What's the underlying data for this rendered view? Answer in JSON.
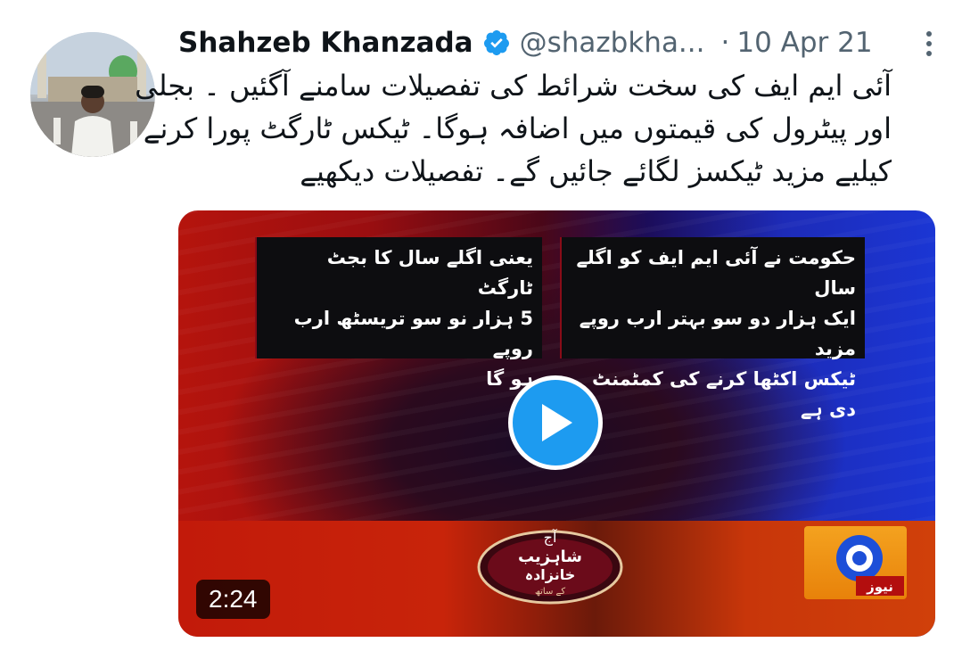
{
  "tweet": {
    "author_name": "Shahzeb Khanzada",
    "handle": "@shazbkha...",
    "separator": "·",
    "date": "10 Apr 21",
    "text_lines": [
      "آئی ایم ایف کی سخت شرائط کی تفصیلات سامنے آگئیں ۔ بجلی",
      "اور پیٹرول کی قیمتوں میں اضافہ ہوگا۔ ٹیکس ٹارگٹ  پورا کرنے",
      "کیلیے مزید ٹیکسز لگائے جائیں گے۔ تفصیلات دیکھیے"
    ]
  },
  "video": {
    "duration": "2:24",
    "panel_left_lines": [
      "یعنی اگلے سال کا بجٹ ٹارگٹ",
      "5 ہزار نو سو تریسٹھ ارب روپے",
      "ہو گا"
    ],
    "panel_right_lines": [
      "حکومت نے آئی ایم ایف کو اگلے سال",
      "ایک ہزار دو سو بہتر ارب روپے مزید",
      "ٹیکس اکٹھا کرنے کی کمٹمنٹ دی ہے"
    ],
    "channel_logo_text": "نیوز",
    "show_logo_lines": [
      "آج",
      "شاہزیب",
      "خانزادہ",
      "کے ساتھ"
    ]
  },
  "colors": {
    "verified": "#1d9bf0",
    "play_button": "#1d9bf0",
    "secondary_text": "#536471"
  },
  "icons": {
    "verified": "verified-badge-icon",
    "more": "more-options-icon",
    "play": "play-icon"
  }
}
